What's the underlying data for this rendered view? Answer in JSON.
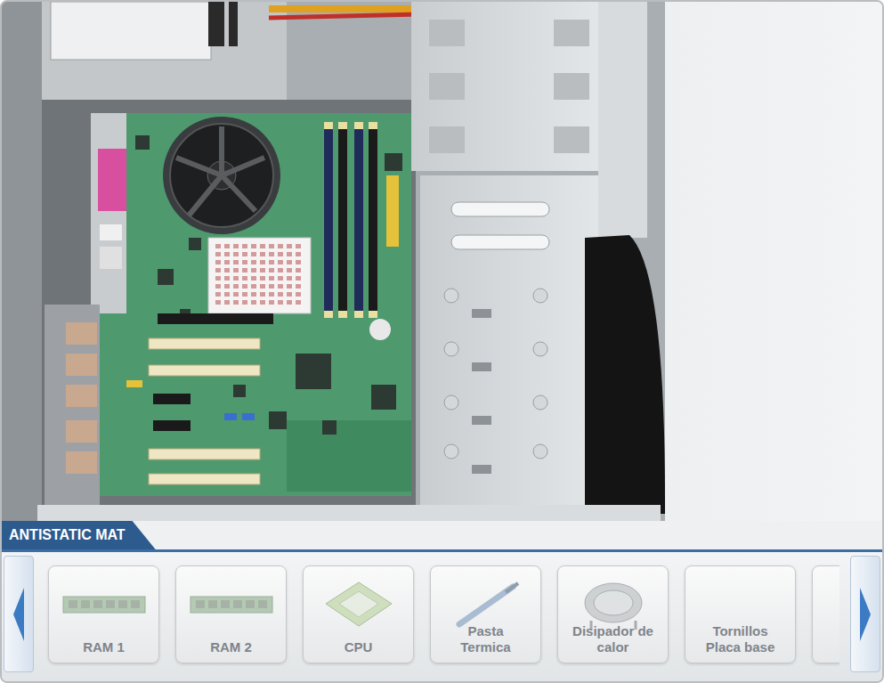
{
  "scene": {
    "label": "ANTISTATIC MAT"
  },
  "tray": {
    "items": [
      {
        "label": "RAM 1",
        "kind": "ram"
      },
      {
        "label": "RAM 2",
        "kind": "ram"
      },
      {
        "label": "CPU",
        "kind": "cpu"
      },
      {
        "label": "Pasta Termica",
        "kind": "paste"
      },
      {
        "label": "Disipador de calor",
        "kind": "heatsink"
      },
      {
        "label": "Tornillos Placa base",
        "kind": "screws"
      },
      {
        "label": "",
        "kind": "card"
      }
    ]
  }
}
